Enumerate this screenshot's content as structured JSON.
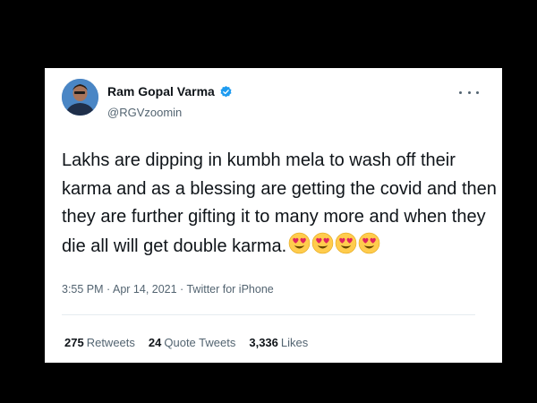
{
  "tweet": {
    "author": {
      "name": "Ram Gopal Varma",
      "handle": "@RGVzoomin",
      "verified": true,
      "avatar_icon": "profile-photo"
    },
    "text_lines": [
      "Lakhs are dipping in kumbh mela to wash off their",
      "karma and as a blessing are getting the covid and then",
      "they are further gifting it to many more and when they",
      "die all will get double karma."
    ],
    "emojis": [
      "heart-eyes-emoji",
      "heart-eyes-emoji",
      "heart-eyes-emoji",
      "heart-eyes-emoji"
    ],
    "meta": {
      "time": "3:55 PM",
      "separator": " · ",
      "date": "Apr 14, 2021",
      "source": "Twitter for iPhone"
    },
    "stats": {
      "retweets": {
        "count": "275",
        "label": "Retweets"
      },
      "quote_tweets": {
        "count": "24",
        "label": "Quote Tweets"
      },
      "likes": {
        "count": "3,336",
        "label": "Likes"
      }
    }
  },
  "colors": {
    "background": "#000000",
    "card": "#ffffff",
    "text": "#0f1419",
    "secondary_text": "#536471",
    "verified": "#1d9bf0",
    "divider": "#e6ecf0"
  }
}
